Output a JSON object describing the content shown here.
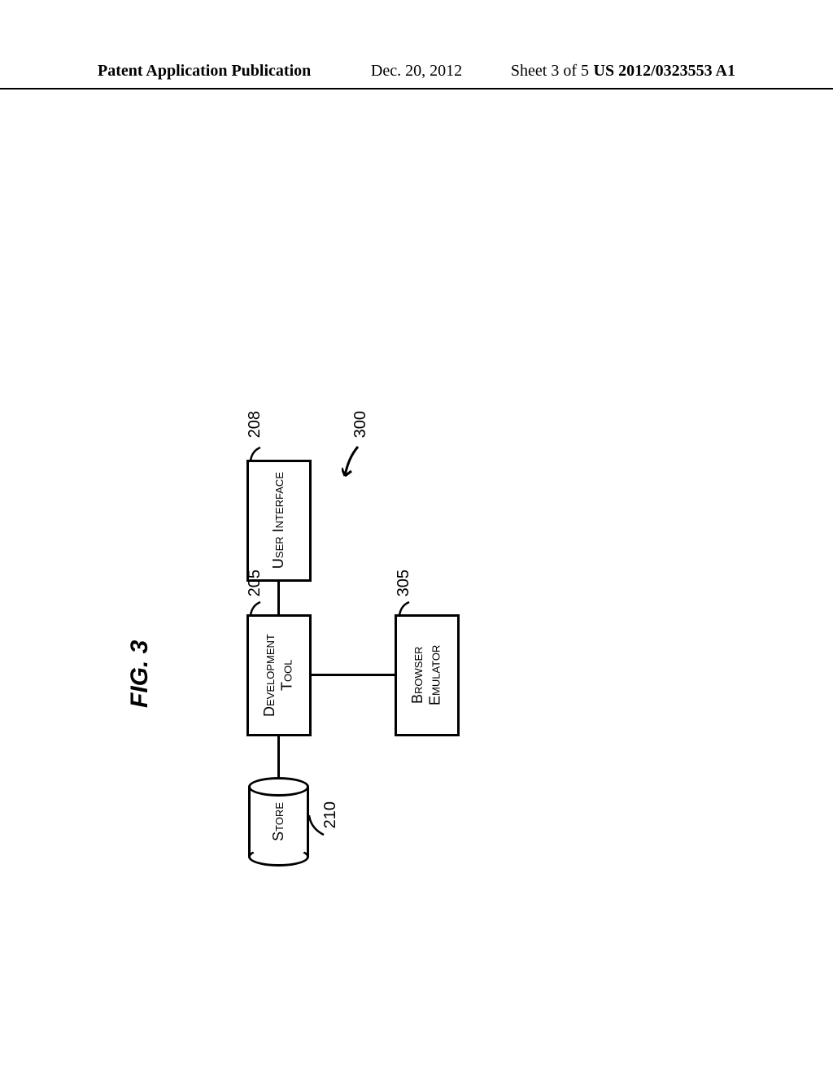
{
  "header": {
    "publication_label": "Patent Application Publication",
    "date": "Dec. 20, 2012",
    "sheet": "Sheet 3 of 5",
    "docnum": "US 2012/0323553 A1"
  },
  "figure": {
    "label": "FIG. 3",
    "system_ref": "300",
    "blocks": {
      "user_interface": {
        "label": "User Interface",
        "ref": "208"
      },
      "development_tool": {
        "label": "Development Tool",
        "ref": "205"
      },
      "browser_emulator": {
        "label": "Browser Emulator",
        "ref": "305"
      },
      "store": {
        "label": "Store",
        "ref": "210"
      }
    }
  }
}
